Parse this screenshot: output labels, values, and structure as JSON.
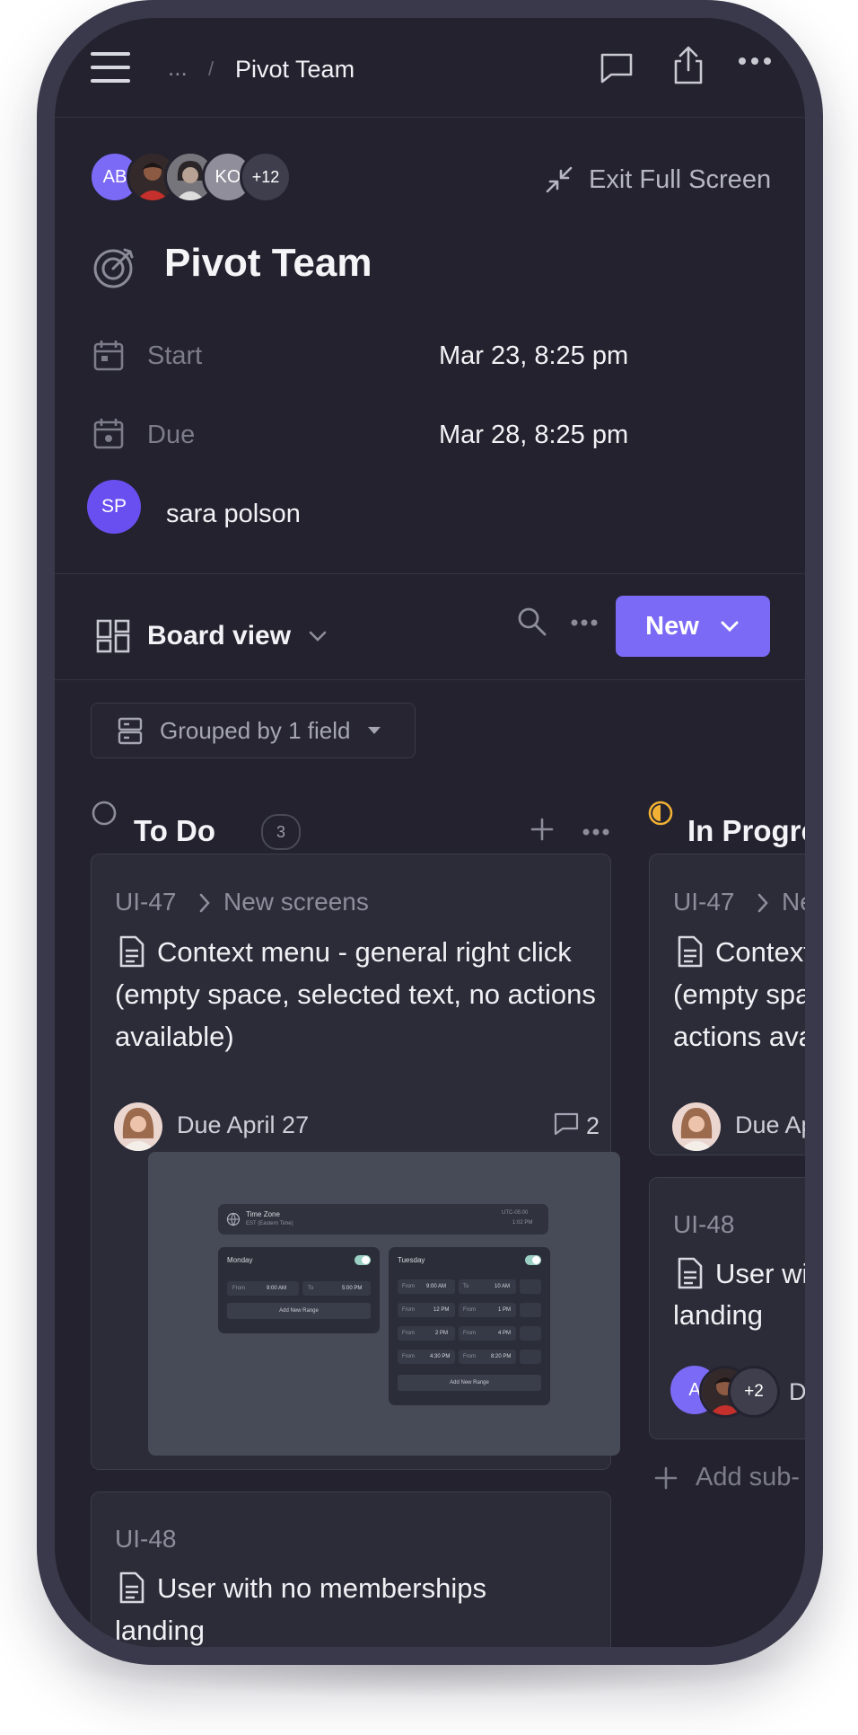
{
  "header": {
    "breadcrumb_ellipsis": "...",
    "breadcrumb_separator": "/",
    "title": "Pivot Team",
    "icons": [
      "menu-icon",
      "comment-icon",
      "share-icon",
      "more-icon"
    ]
  },
  "members": {
    "avatars": [
      {
        "initials": "AB",
        "color": "#7b6af5"
      },
      {
        "initials": "",
        "color": "#b2533b"
      },
      {
        "initials": "",
        "color": "#7c7a80"
      },
      {
        "initials": "KO",
        "color": "#8f8e9a"
      }
    ],
    "overflow": "+12"
  },
  "exit_fullscreen_label": "Exit Full Screen",
  "project": {
    "title": "Pivot Team",
    "start_label": "Start",
    "start_value": "Mar 23, 8:25 pm",
    "due_label": "Due",
    "due_value": "Mar 28, 8:25 pm",
    "assignee_initials": "SP",
    "assignee_name": "sara polson"
  },
  "toolbar": {
    "view_label": "Board view",
    "new_label": "New"
  },
  "grouping_label": "Grouped by 1 field",
  "columns": [
    {
      "title": "To Do",
      "count": "3",
      "cards": [
        {
          "id": "UI-47",
          "parent": "New screens",
          "title": "Context menu - general right click (empty space, selected text, no actions available)",
          "due": "Due April 27",
          "comments": "2"
        },
        {
          "id": "UI-48",
          "title": "User with no memberships landing"
        }
      ]
    },
    {
      "title": "In Progre",
      "cards": [
        {
          "id": "UI-47",
          "parent": "Ne",
          "title": "Context menu - general right click (empty space, selected text, no actions available)",
          "title_lines": [
            "Context",
            "(empty spa",
            "actions ava"
          ],
          "due": "Due Ap"
        },
        {
          "id": "UI-48",
          "title_lines": [
            "User wi",
            "landing"
          ],
          "assignee_initial": "A",
          "overflow": "+2",
          "due": "Du"
        }
      ],
      "add_subtask": "Add sub-"
    }
  ],
  "preview": {
    "timezone_title": "Time Zone",
    "timezone_sub": "EST (Eastern Time)",
    "timezone_offset": "UTC-05:00",
    "timezone_time": "1:02 PM",
    "monday": {
      "label": "Monday",
      "rows": [
        {
          "from_label": "From",
          "from": "9:00 AM",
          "to_label": "To",
          "to": "5:00 PM"
        }
      ],
      "add": "Add New Range"
    },
    "tuesday": {
      "label": "Tuesday",
      "rows": [
        {
          "from_label": "From",
          "from": "9:00 AM",
          "to_label": "To",
          "to": "10 AM"
        },
        {
          "from_label": "From",
          "from": "12 PM",
          "to_label": "From",
          "to": "1 PM"
        },
        {
          "from_label": "From",
          "from": "2 PM",
          "to_label": "From",
          "to": "4 PM"
        },
        {
          "from_label": "From",
          "from": "4:30 PM",
          "to_label": "From",
          "to": "8:20 PM"
        }
      ],
      "add": "Add New Range"
    }
  },
  "colors": {
    "accent": "#7b6af5",
    "background": "#23222e",
    "card": "#2c2b38",
    "in_progress": "#f2b134"
  }
}
